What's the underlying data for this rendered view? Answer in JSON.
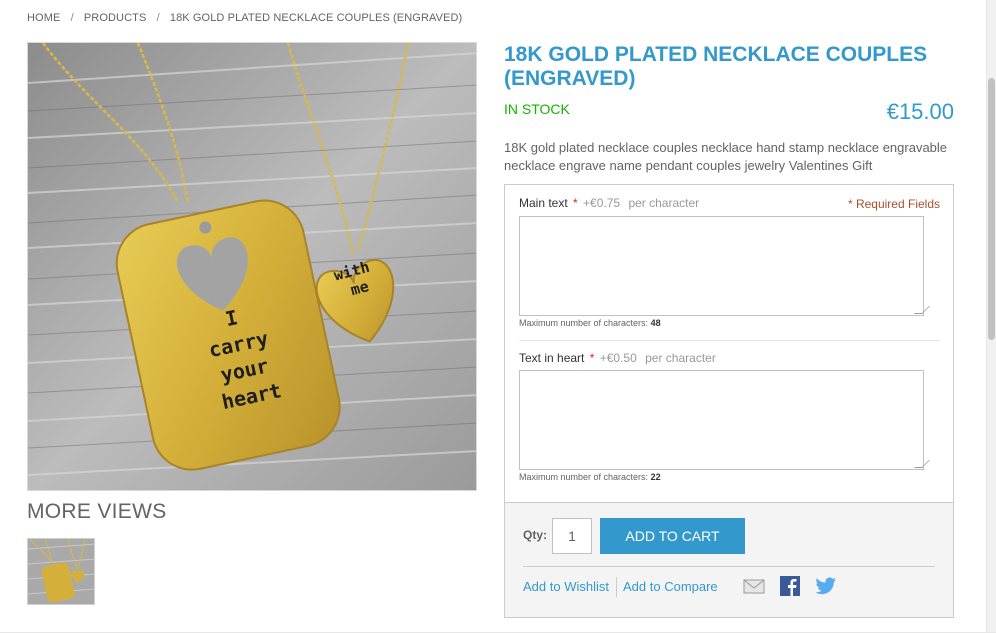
{
  "breadcrumb": {
    "home": "HOME",
    "products": "PRODUCTS",
    "current": "18K GOLD PLATED NECKLACE COUPLES (ENGRAVED)",
    "separator": "/"
  },
  "gallery": {
    "main_image_alt": "gold-necklaces-photo",
    "main_engraving": [
      "I",
      "carry",
      "your",
      "heart"
    ],
    "heart_engraving": [
      "with",
      "me"
    ],
    "more_views_title": "MORE VIEWS"
  },
  "product": {
    "name": "18K GOLD PLATED NECKLACE COUPLES (ENGRAVED)",
    "stock": "IN STOCK",
    "price": "€15.00",
    "description": "18K gold plated necklace couples necklace hand stamp necklace engravable necklace engrave name pendant couples jewelry Valentines Gift"
  },
  "options": {
    "required_note": "* Required Fields",
    "main_text": {
      "label": "Main text",
      "star": "*",
      "price": "+€0.75",
      "unit": "per character",
      "value": "",
      "max_label": "Maximum number of characters:",
      "max_value": "48"
    },
    "heart_text": {
      "label": "Text in heart",
      "star": "*",
      "price": "+€0.50",
      "unit": "per character",
      "value": "",
      "max_label": "Maximum number of characters:",
      "max_value": "22"
    }
  },
  "cart": {
    "qty_label": "Qty:",
    "qty_value": "1",
    "add_button": "ADD TO CART",
    "wishlist": "Add to Wishlist",
    "compare": "Add to Compare"
  },
  "social": {
    "icons": [
      "email-icon",
      "facebook-icon",
      "twitter-icon"
    ]
  },
  "colors": {
    "accent": "#3399cc",
    "stock": "#11b400",
    "required": "#a5512f",
    "gold": "#d6b43c"
  }
}
